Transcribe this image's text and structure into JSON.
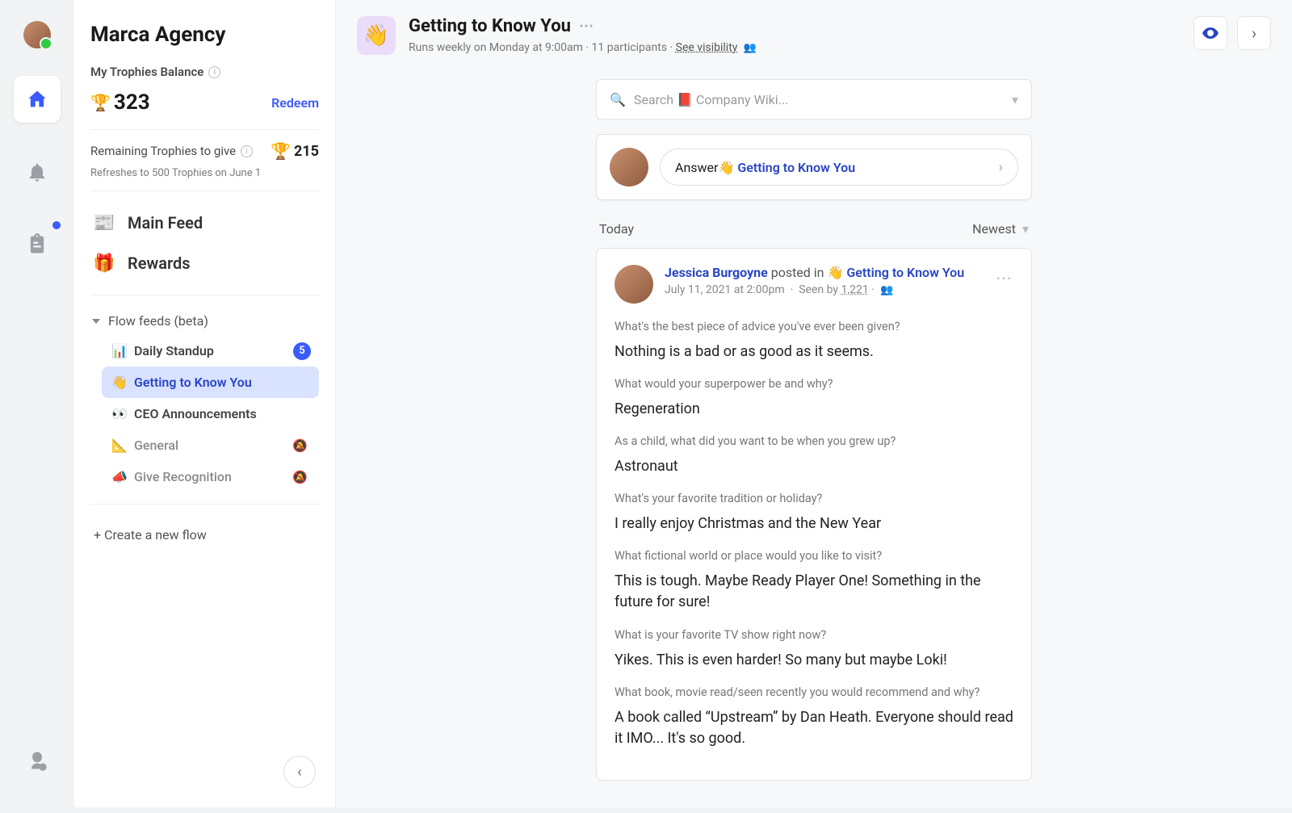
{
  "agency": "Marca Agency",
  "trophies": {
    "label": "My Trophies Balance",
    "value": "323",
    "redeem": "Redeem",
    "remaining_label": "Remaining Trophies to give",
    "remaining_value": "215",
    "refresh_note": "Refreshes to 500 Trophies on June 1"
  },
  "nav": {
    "main_feed": "Main Feed",
    "rewards": "Rewards"
  },
  "flow_section": {
    "title": "Flow feeds (beta)",
    "items": [
      {
        "emoji": "📊",
        "label": "Daily Standup",
        "badge": "5"
      },
      {
        "emoji": "👋",
        "label": "Getting to Know You"
      },
      {
        "emoji": "👀",
        "label": "CEO Announcements"
      },
      {
        "emoji": "📐",
        "label": "General"
      },
      {
        "emoji": "📣",
        "label": "Give Recognition"
      }
    ],
    "create": "+ Create a new flow"
  },
  "header": {
    "title": "Getting to Know You",
    "subtitle_a": "Runs weekly on Monday at 9:00am",
    "subtitle_b": "11 participants",
    "subtitle_link": "See visibility"
  },
  "search": {
    "placeholder": "Search 📕 Company Wiki..."
  },
  "answer": {
    "prefix": "Answer ",
    "emoji": "👋",
    "flow": "Getting to Know You"
  },
  "list": {
    "today": "Today",
    "sort": "Newest"
  },
  "post": {
    "author": "Jessica Burgoyne",
    "posted_in": " posted in ",
    "flow_emoji": "👋",
    "flow": "Getting to Know You",
    "date": "July 11, 2021 at 2:00pm",
    "seen_label": "Seen by ",
    "seen_count": "1,221",
    "qa": [
      {
        "q": "What's the best piece of advice you've ever been given?",
        "a": "Nothing is a bad or as good as it seems."
      },
      {
        "q": "What would your superpower be and why?",
        "a": "Regeneration"
      },
      {
        "q": "As a child, what did you want to be when you grew up?",
        "a": "Astronaut"
      },
      {
        "q": "What's your favorite tradition or holiday?",
        "a": "I really enjoy Christmas and the New Year"
      },
      {
        "q": "What fictional world or place would you like to visit?",
        "a": "This is tough. Maybe Ready Player One! Something in the future for sure!"
      },
      {
        "q": "What is your favorite TV show right now?",
        "a": "Yikes. This is even harder! So many but maybe Loki!"
      },
      {
        "q": "What book, movie read/seen recently you would recommend and why?",
        "a": "A book called “Upstream” by Dan Heath. Everyone should read it IMO... It's so good."
      }
    ]
  }
}
